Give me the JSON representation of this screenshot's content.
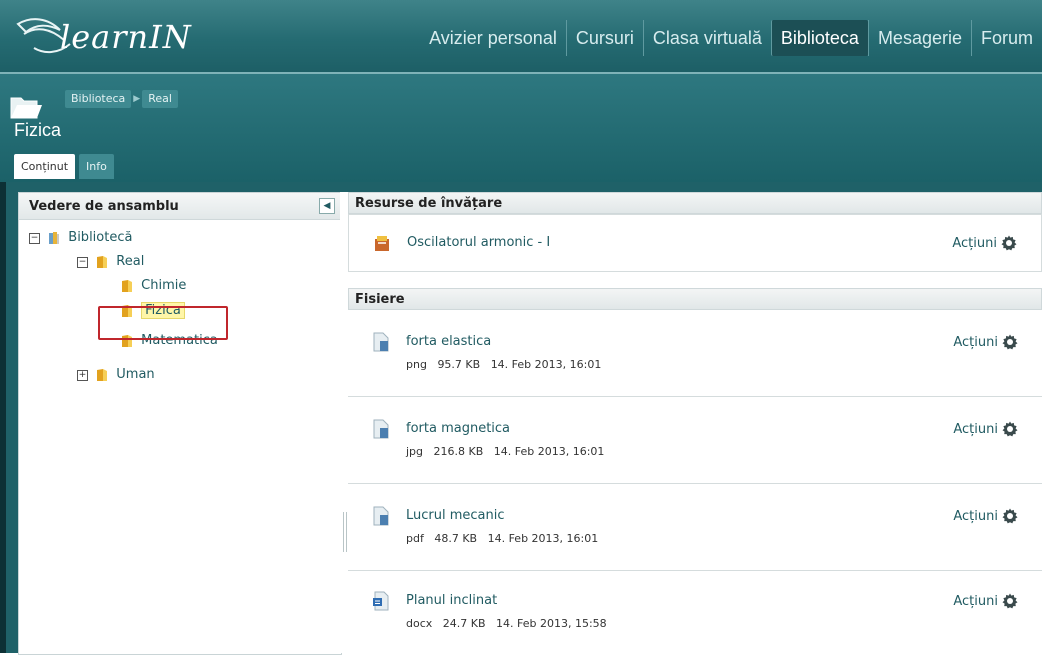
{
  "app": {
    "logo_text": "learnIN"
  },
  "nav": {
    "items": [
      {
        "label": "Avizier personal",
        "active": false
      },
      {
        "label": "Cursuri",
        "active": false
      },
      {
        "label": "Clasa virtuală",
        "active": false
      },
      {
        "label": "Biblioteca",
        "active": true
      },
      {
        "label": "Mesagerie",
        "active": false
      },
      {
        "label": "Forum",
        "active": false
      }
    ]
  },
  "header": {
    "breadcrumb": [
      "Biblioteca",
      "Real"
    ],
    "title": "Fizica",
    "tabs": [
      {
        "label": "Conținut",
        "active": true
      },
      {
        "label": "Info",
        "active": false
      }
    ]
  },
  "tree": {
    "title": "Vedere de ansamblu",
    "collapse_icon": "◀",
    "nodes": [
      {
        "label": "Bibliotecă",
        "toggle": "−",
        "level": 0
      },
      {
        "label": "Real",
        "toggle": "−",
        "level": 1
      },
      {
        "label": "Chimie",
        "toggle": "",
        "level": 2
      },
      {
        "label": "Fizica",
        "toggle": "",
        "level": 2,
        "selected": true
      },
      {
        "label": "Matematica",
        "toggle": "",
        "level": 2
      },
      {
        "label": "Uman",
        "toggle": "+",
        "level": 1
      }
    ]
  },
  "sections": {
    "learning": {
      "title": "Resurse de învățare",
      "items": [
        {
          "title": "Oscilatorul armonic - I",
          "actions": "Acțiuni"
        }
      ]
    },
    "files": {
      "title": "Fisiere",
      "items": [
        {
          "title": "forta elastica",
          "type": "png",
          "size": "95.7 KB",
          "date": "14. Feb 2013, 16:01",
          "actions": "Acțiuni"
        },
        {
          "title": "forta magnetica",
          "type": "jpg",
          "size": "216.8 KB",
          "date": "14. Feb 2013, 16:01",
          "actions": "Acțiuni"
        },
        {
          "title": "Lucrul mecanic",
          "type": "pdf",
          "size": "48.7 KB",
          "date": "14. Feb 2013, 16:01",
          "actions": "Acțiuni"
        },
        {
          "title": "Planul inclinat",
          "type": "docx",
          "size": "24.7 KB",
          "date": "14. Feb 2013, 15:58",
          "actions": "Acțiuni"
        }
      ]
    }
  },
  "colors": {
    "accent": "#215b62",
    "topbar": "#256b72",
    "highlight": "#c0262c",
    "selected_bg": "#fff6a8"
  }
}
